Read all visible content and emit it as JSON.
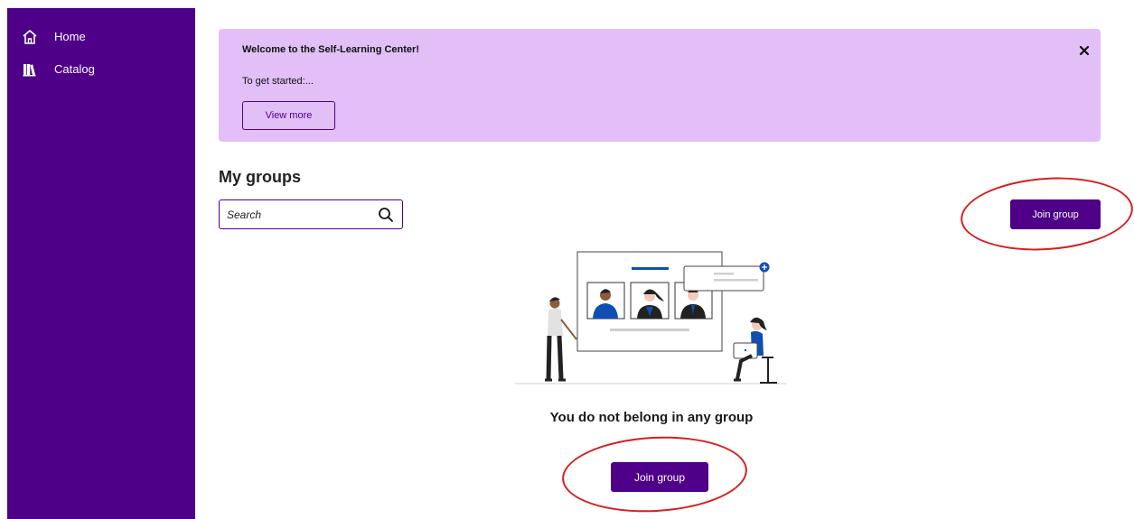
{
  "sidebar": {
    "items": [
      {
        "label": "Home",
        "icon": "home-icon"
      },
      {
        "label": "Catalog",
        "icon": "books-icon"
      }
    ],
    "background": "#4e0089"
  },
  "banner": {
    "title": "Welcome to the Self-Learning Center!",
    "text": "To get started:...",
    "button_label": "View more",
    "close_icon": "close-icon",
    "background": "#e2bff7"
  },
  "groups": {
    "title": "My groups",
    "search_placeholder": "Search",
    "join_label": "Join group",
    "empty_message": "You do not belong in any group",
    "empty_join_label": "Join group"
  },
  "colors": {
    "accent": "#4e0089",
    "annotation": "#d61f1f"
  }
}
